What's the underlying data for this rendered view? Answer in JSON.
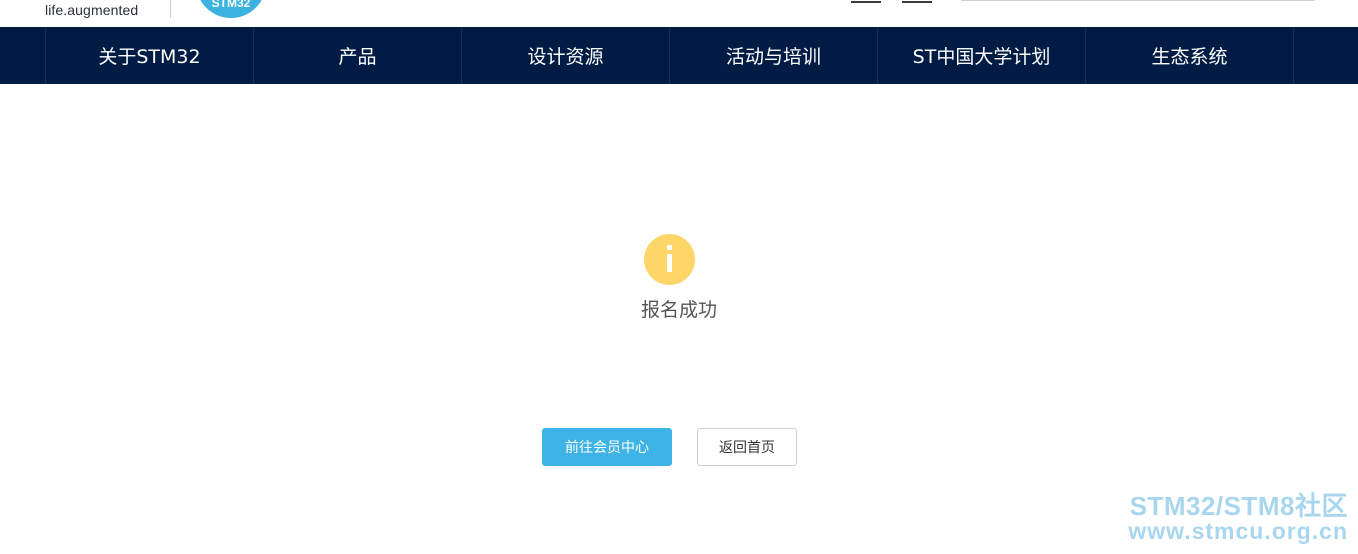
{
  "header": {
    "tagline": "life.augmented",
    "badge_text": "STM32"
  },
  "nav": {
    "items": [
      {
        "label": "关于STM32"
      },
      {
        "label": "产品"
      },
      {
        "label": "设计资源"
      },
      {
        "label": "活动与培训"
      },
      {
        "label": "ST中国大学计划"
      },
      {
        "label": "生态系统"
      }
    ]
  },
  "result": {
    "icon": "info-icon",
    "icon_color": "#fdd667",
    "title": "报名成功"
  },
  "actions": {
    "primary_label": "前往会员中心",
    "secondary_label": "返回首页",
    "primary_color": "#3db3e6"
  },
  "watermark": {
    "line1": "STM32/STM8社区",
    "line2": "www.stmcu.org.cn"
  },
  "colors": {
    "nav_background": "#001c45"
  }
}
